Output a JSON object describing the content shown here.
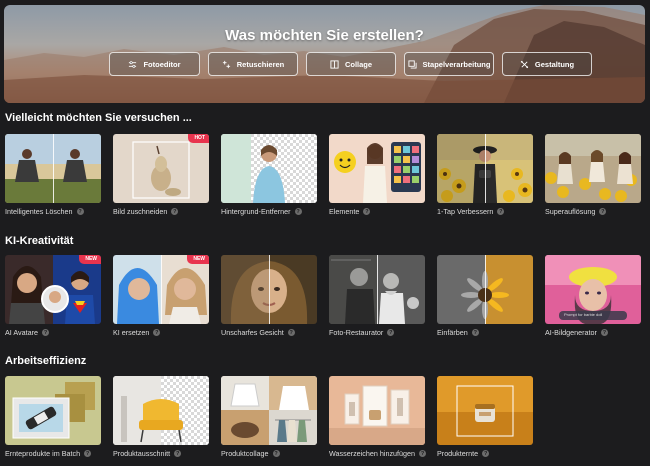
{
  "hero": {
    "title": "Was möchten Sie erstellen?",
    "buttons": [
      {
        "label": "Fotoeditor",
        "icon": "sliders-icon"
      },
      {
        "label": "Retuschieren",
        "icon": "sparkle-icon"
      },
      {
        "label": "Collage",
        "icon": "collage-icon"
      },
      {
        "label": "Stapelverarbeitung",
        "icon": "stack-icon"
      },
      {
        "label": "Gestaltung",
        "icon": "design-icon"
      }
    ]
  },
  "sections": [
    {
      "title": "Vielleicht möchten Sie versuchen ...",
      "items": [
        {
          "label": "Intelligentes Löschen"
        },
        {
          "label": "Bild zuschneiden",
          "badge": "HOT"
        },
        {
          "label": "Hintergrund-Entferner"
        },
        {
          "label": "Elemente"
        },
        {
          "label": "1-Tap Verbessern"
        },
        {
          "label": "Superauflösung"
        }
      ]
    },
    {
      "title": "KI-Kreativität",
      "items": [
        {
          "label": "AI Avatare",
          "badge": "NEW"
        },
        {
          "label": "KI ersetzen",
          "badge": "NEW"
        },
        {
          "label": "Unscharfes Gesicht"
        },
        {
          "label": "Foto-Restaurator"
        },
        {
          "label": "Einfärben"
        },
        {
          "label": "AI-Bildgenerator",
          "prompt_text": "Prompt for barbie doll"
        }
      ]
    },
    {
      "title": "Arbeitseffizienz",
      "items": [
        {
          "label": "Ernteprodukte im Batch"
        },
        {
          "label": "Produktausschnitt"
        },
        {
          "label": "Produktcollage"
        },
        {
          "label": "Wasserzeichen hinzufügen"
        },
        {
          "label": "Produkternte"
        }
      ]
    }
  ],
  "colors": {
    "background": "#1c1c1e",
    "hot_badge": "#e8344e",
    "new_badge": "#e8344e",
    "info_icon": "#6c6c6c"
  }
}
